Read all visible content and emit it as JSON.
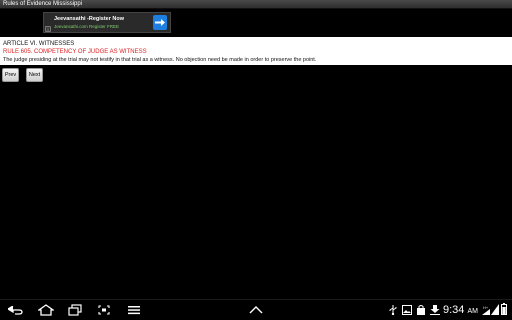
{
  "app": {
    "title": "Rules of Evidence Mississippi"
  },
  "ad": {
    "title": "Jeevansathi -Register Now",
    "subtitle": "Jeevansathi.com Register FREE",
    "info_symbol": "i"
  },
  "content": {
    "article_heading": "ARTICLE VI. WITNESSES",
    "rule_heading": "RULE 605. COMPETENCY OF JUDGE AS WITNESS",
    "rule_text": "The judge presiding at the trial may not testify in that trial as a witness. No objection need be made in order to preserve the point."
  },
  "navigation": {
    "prev_label": "Prev",
    "next_label": "Next"
  },
  "system_bar": {
    "clock": "9:34",
    "ampm": "AM",
    "network_label": "H+",
    "icons": [
      "back-icon",
      "home-icon",
      "recent-apps-icon",
      "screenshot-icon",
      "menu-icon",
      "up-arrow-icon",
      "usb-icon",
      "image-icon",
      "shopping-bag-icon",
      "download-icon",
      "wifi-signal-icon",
      "cell-signal-icon",
      "battery-icon"
    ],
    "colors": {
      "background": "#000000",
      "icon": "#ffffff"
    }
  },
  "colors": {
    "rule_heading": "#dd2222",
    "ad_button": "#1e7fe0",
    "page_background": "#000000"
  }
}
